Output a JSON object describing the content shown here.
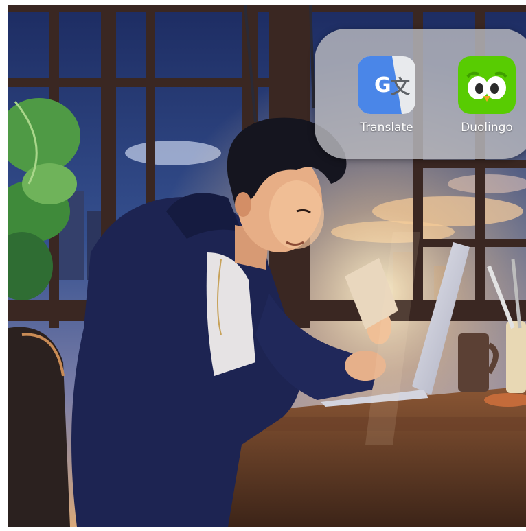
{
  "folder": {
    "apps": [
      {
        "label": "Translate",
        "icon": "google-translate-icon",
        "colors": {
          "primary": "#4a86e8",
          "secondary": "#e8eaed",
          "glyph": "#ffffff",
          "glyph_dark": "#5f6368"
        },
        "glyphs": {
          "latin": "G",
          "cjk": "文"
        }
      },
      {
        "label": "Duolingo",
        "icon": "duolingo-owl-icon",
        "colors": {
          "primary": "#58cc02",
          "eye": "#ffffff",
          "pupil": "#2b2b2b",
          "beak": "#f5a623"
        }
      }
    ]
  },
  "wallpaper": {
    "description_icon": "anime-student-laptop-wallpaper",
    "colors": {
      "sky": "#2a3f7a",
      "sunset": "#f3c48a",
      "hoodie": "#1c2350",
      "desk": "#5a3a26",
      "window_frame": "#3a2a28"
    }
  }
}
